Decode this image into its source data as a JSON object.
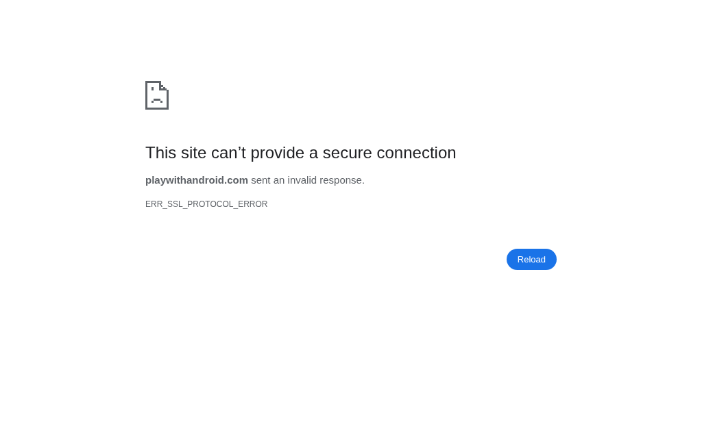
{
  "heading": "This site can’t provide a secure connection",
  "message": "**playwithandroid.com** sent an invalid response.",
  "error_code": "ERR_SSL_PROTOCOL_ERROR",
  "reload_button": {
    "label": "Reload"
  }
}
